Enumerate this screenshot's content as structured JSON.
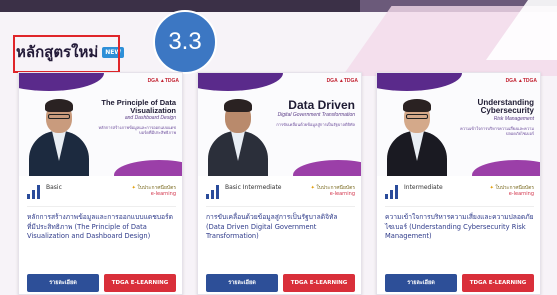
{
  "annotation": {
    "step": "3.3"
  },
  "section": {
    "title": "หลักสูตรใหม่",
    "badge": "NEW"
  },
  "cards": [
    {
      "cover_logo": "DGA ▲TDGA",
      "cover_title": "The Principle of Data Visualization",
      "cover_subtitle": "and Dashboard Design",
      "cover_desc": "หลักการสร้างภาพข้อมูลและการออกแบบแดชบอร์ดที่มีประสิทธิภาพ",
      "level": "Basic",
      "cert_label": "ใบประกาศนียบัตร",
      "cert_sub": "e-learning",
      "description": "หลักการสร้างภาพข้อมูลและการออกแบบแดชบอร์ดที่มีประสิทธิภาพ (The Principle of Data Visualization and Dashboard Design)",
      "detail_button": "รายละเอียด",
      "elearning_button": "TDGA E-LEARNING"
    },
    {
      "cover_logo": "DGA ▲TDGA",
      "cover_title": "Data Driven",
      "cover_subtitle": "Digital Government Transformation",
      "cover_desc": "การขับเคลื่อนด้วยข้อมูลสู่การเป็นรัฐบาลดิจิทัล",
      "level": "Basic Intermediate",
      "cert_label": "ใบประกาศนียบัตร",
      "cert_sub": "e-learning",
      "description": "การขับเคลื่อนด้วยข้อมูลสู่การเป็นรัฐบาลดิจิทัล (Data Driven Digital Government Transformation)",
      "detail_button": "รายละเอียด",
      "elearning_button": "TDGA E-LEARNING"
    },
    {
      "cover_logo": "DGA ▲TDGA",
      "cover_title": "Understanding Cybersecurity",
      "cover_subtitle": "Risk Management",
      "cover_desc": "ความเข้าใจการบริหารความเสี่ยงและความปลอดภัยไซเบอร์",
      "level": "Intermediate",
      "cert_label": "ใบประกาศนียบัตร",
      "cert_sub": "e-learning",
      "description": "ความเข้าใจการบริหารความเสี่ยงและความปลอดภัยไซเบอร์ (Understanding Cybersecurity Risk Management)",
      "detail_button": "รายละเอียด",
      "elearning_button": "TDGA E-LEARNING"
    }
  ],
  "colors": {
    "primary": "#2d4f98",
    "accent": "#d92f3a",
    "annotation": "#3c77c3",
    "highlight_box": "#e0252a"
  },
  "icons": {
    "level": "bar-chart-icon",
    "certificate": "certificate-icon"
  }
}
